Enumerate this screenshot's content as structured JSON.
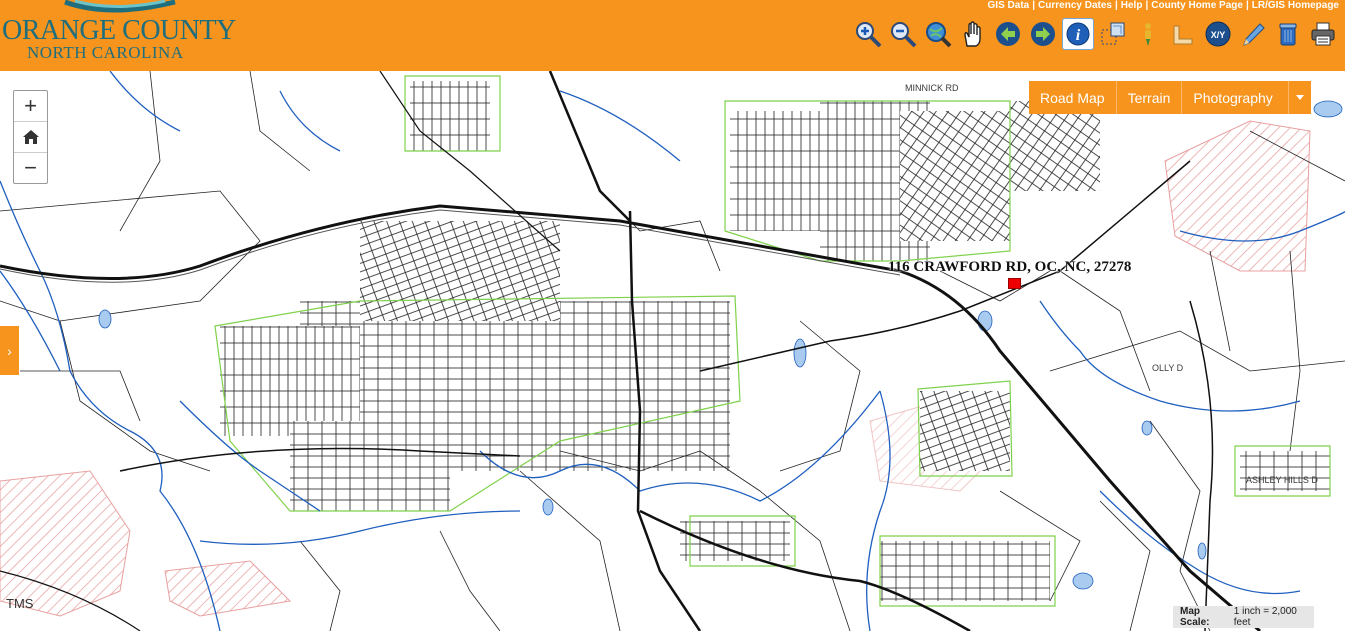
{
  "header": {
    "county_name": "ORANGE COUNTY",
    "state_name": "NORTH CAROLINA",
    "links": [
      "GIS Data",
      "Currency Dates",
      "Help",
      "County Home Page",
      "LR/GIS Homepage"
    ]
  },
  "toolbar": {
    "tools": [
      {
        "name": "zoom-in-tool",
        "icon": "magnifier-plus-icon"
      },
      {
        "name": "zoom-out-tool",
        "icon": "magnifier-minus-icon"
      },
      {
        "name": "full-extent-tool",
        "icon": "globe-magnifier-icon"
      },
      {
        "name": "pan-tool",
        "icon": "hand-icon"
      },
      {
        "name": "previous-extent-tool",
        "icon": "arrow-left-icon"
      },
      {
        "name": "next-extent-tool",
        "icon": "arrow-right-icon"
      },
      {
        "name": "identify-tool",
        "icon": "info-icon",
        "active": true
      },
      {
        "name": "select-tool",
        "icon": "select-map-icon"
      },
      {
        "name": "street-view-tool",
        "icon": "pegman-icon"
      },
      {
        "name": "measure-tool",
        "icon": "ruler-icon"
      },
      {
        "name": "xy-tool",
        "icon": "xy-icon",
        "label": "X/Y"
      },
      {
        "name": "draw-tool",
        "icon": "pencil-icon"
      },
      {
        "name": "clear-tool",
        "icon": "trash-icon"
      },
      {
        "name": "print-tool",
        "icon": "printer-icon"
      }
    ]
  },
  "basemap": {
    "options": [
      "Road Map",
      "Terrain",
      "Photography"
    ],
    "dropdown_icon": "caret-down-icon"
  },
  "zoom": {
    "in_label": "+",
    "home_icon": "home-icon",
    "out_label": "−"
  },
  "side_panel": {
    "toggle_glyph": "›"
  },
  "map": {
    "address_label": "116 CRAWFORD RD, OC, NC, 27278",
    "partial_label": "TMS",
    "road_labels": [
      "MINNICK RD",
      "OLLY D",
      "ASHLEY HILLS D"
    ],
    "scale_label": "Map Scale:",
    "scale_value": "1 inch = 2,000 feet"
  },
  "colors": {
    "header_orange": "#f7941d",
    "logo_teal": "#1f6e7e",
    "parcel_line": "#000000",
    "road_line": "#111111",
    "stream_blue": "#1f5fbf",
    "green_outline": "#7fd14a",
    "hatch_pink": "#e8a0a0",
    "marker_red": "#e00000"
  }
}
